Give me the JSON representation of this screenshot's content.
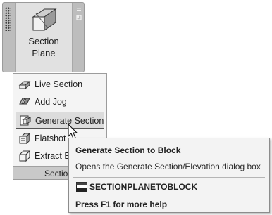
{
  "ribbon": {
    "button_label_line1": "Section",
    "button_label_line2": "Plane",
    "button_icon": "section-plane-icon"
  },
  "menu": {
    "items": [
      {
        "label": "Live Section",
        "icon": "live-section-icon"
      },
      {
        "label": "Add Jog",
        "icon": "add-jog-icon"
      },
      {
        "label": "Generate Section",
        "icon": "generate-section-icon",
        "highlighted": true
      },
      {
        "label": "Flatshot",
        "icon": "flatshot-icon"
      },
      {
        "label": "Extract Ed",
        "icon": "extract-edges-icon"
      }
    ],
    "footer": "Section"
  },
  "tooltip": {
    "title": "Generate Section to Block",
    "description": "Opens the Generate Section/Elevation dialog box",
    "command": "SECTIONPLANETOBLOCK",
    "command_icon": "command-line-icon",
    "help": "Press F1 for more help"
  }
}
